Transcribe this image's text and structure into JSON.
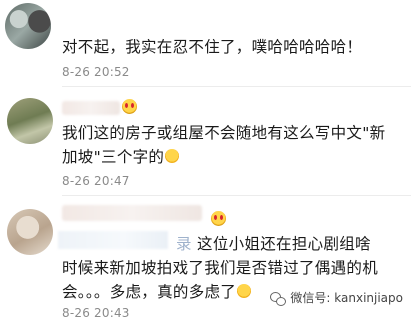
{
  "comments": [
    {
      "text": "对不起，我实在忍不住了，噗哈哈哈哈哈！",
      "time": "8-26 20:52"
    },
    {
      "text_line1": "我们这的房子或组屋不会随地有这么写中文\"新",
      "text_line2": "加坡\"三个字的",
      "time": "8-26 20:47"
    },
    {
      "text_prefix": "录",
      "text_line1": "这位小姐还在担心剧组啥",
      "text_line2": "时候来新加坡拍戏了我们是否错过了偶遇的机",
      "text_line3": "会。。。多虑，真的多虑了",
      "time": "8-26 20:43"
    }
  ],
  "watermark": {
    "label": "微信号: kanxinjiapo",
    "icon": "wechat-icon"
  }
}
